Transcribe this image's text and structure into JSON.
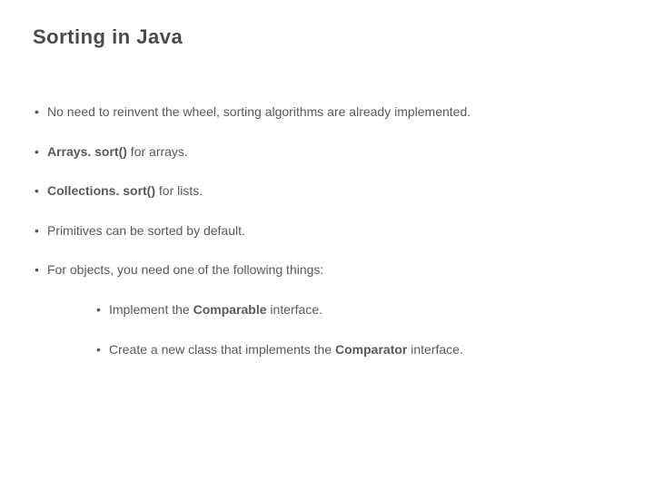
{
  "title": "Sorting in Java",
  "bullets": [
    {
      "prefix": "",
      "bold": "",
      "suffix": "No need to reinvent the wheel, sorting algorithms are already implemented."
    },
    {
      "prefix": "",
      "bold": "Arrays. sort()",
      "suffix": " for arrays."
    },
    {
      "prefix": "",
      "bold": "Collections. sort()",
      "suffix": " for lists."
    },
    {
      "prefix": "",
      "bold": "",
      "suffix": "Primitives can be sorted by default."
    },
    {
      "prefix": "",
      "bold": "",
      "suffix": "For objects, you need one of the following things:"
    }
  ],
  "subbullets": [
    {
      "prefix": "Implement the ",
      "bold": "Comparable",
      "suffix": " interface."
    },
    {
      "prefix": "Create a new class that implements the ",
      "bold": "Comparator",
      "suffix": " interface."
    }
  ]
}
